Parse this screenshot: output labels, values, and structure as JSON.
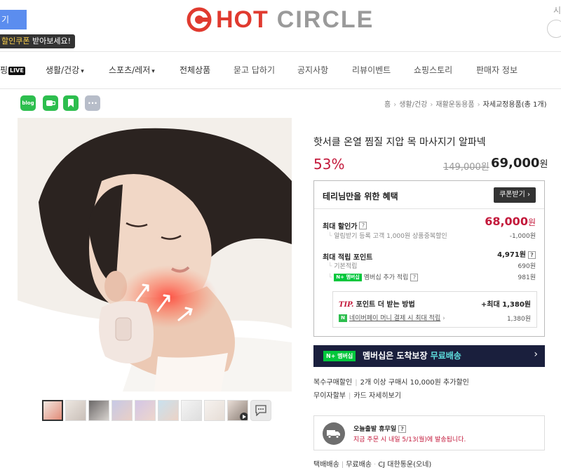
{
  "header": {
    "top_button": "기",
    "coupon_tip": {
      "highlight": "할인쿠폰",
      "rest": " 받아보세요!"
    },
    "logo": {
      "word1": "HOT",
      "word2": "CIRCLE"
    },
    "top_right_text": "시"
  },
  "nav": {
    "items": [
      {
        "label": "핑",
        "badge": "LIVE"
      },
      {
        "label": "생활/건강",
        "caret": "▾"
      },
      {
        "label": "스포츠/레저",
        "caret": "▾"
      },
      {
        "label": "전체상품"
      },
      {
        "label": "묻고 답하기"
      },
      {
        "label": "공지사항"
      },
      {
        "label": "리뷰이벤트"
      },
      {
        "label": "쇼핑스토리"
      },
      {
        "label": "판매자 정보"
      }
    ]
  },
  "share": {
    "blog_label": "blog",
    "more_label": "···"
  },
  "breadcrumb": [
    "홈",
    "생활/건강",
    "재활운동용품",
    "자세교정용품(총 1개)"
  ],
  "product": {
    "title": "핫서클 온열 찜질 지압 목 마사지기 알파넥",
    "discount": "53%",
    "original_price": "149,000원",
    "price": "69,000",
    "price_unit": "원"
  },
  "benefit": {
    "title": "테리님만을 위한 혜택",
    "coupon_button": "쿠폰받기 ›",
    "max_discount_label": "최대 할인가",
    "max_discount_price": "68,000",
    "price_unit": "원",
    "discount_detail": "알림받기 등록 고객 1,000원 상품중복할인",
    "discount_amount": "-1,000원",
    "points_label": "최대 적립 포인트",
    "points_total": "4,971원",
    "basic_label": "기본적립",
    "basic_value": "690원",
    "member_badge": "N+ 멤버십",
    "member_label": "멤버십 추가 적립",
    "member_value": "981원",
    "tip_label": "TIP.",
    "tip_text": "포인트 더 받는 방법",
    "tip_max": "+최대 1,380원",
    "npay_label": "N",
    "npay_text": "네이버페이 머니 결제 시 최대 적립",
    "npay_value": "1,380원"
  },
  "membership": {
    "badge": "N+ 멤버십",
    "text_plain": "멤버십은 도착보장 ",
    "text_accent": "무료배송",
    "arrow": "›"
  },
  "info": {
    "multi_label": "복수구매할인",
    "multi_value": "2개 이상 구매시 10,000원 추가할인",
    "installment_label": "무이자할부",
    "installment_value": "카드 자세히보기"
  },
  "shipping": {
    "title": "오늘출발 휴무일",
    "subtitle": "지금 주문 시 내일 5/13(월)에 발송됩니다.",
    "type": "택배배송",
    "fee": "무료배송",
    "carrier": "CJ 대한통운(오네)"
  }
}
